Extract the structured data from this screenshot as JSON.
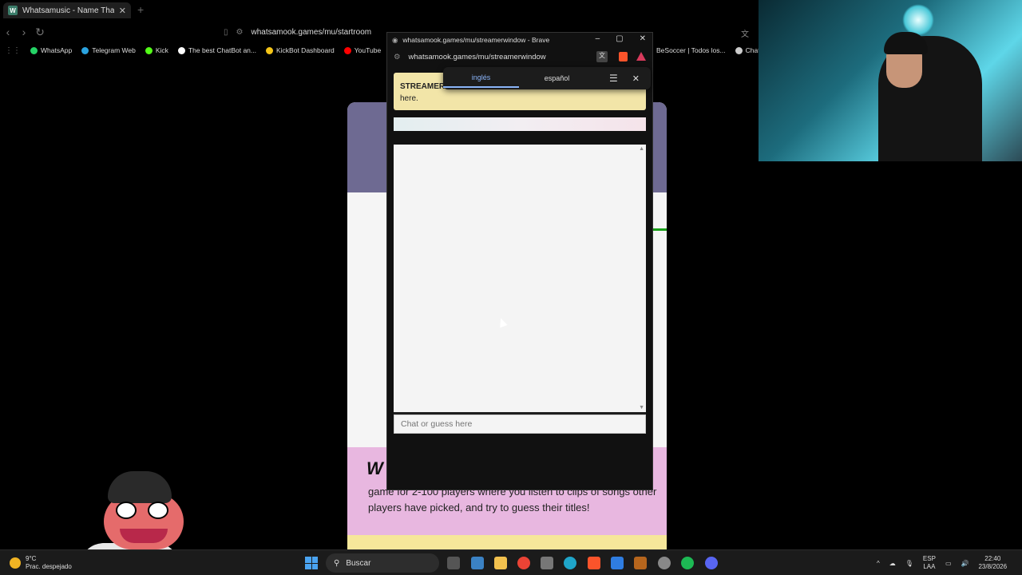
{
  "browser": {
    "tab_title": "Whatsamusic - Name That Tune",
    "tab_favicon": "W",
    "url": "whatsamook.games/mu/startroom",
    "bookmarks": [
      {
        "label": "WhatsApp",
        "color": "#25d366"
      },
      {
        "label": "Telegram Web",
        "color": "#2aa3e0"
      },
      {
        "label": "Kick",
        "color": "#53fc18"
      },
      {
        "label": "The best ChatBot an...",
        "color": "#ffffff"
      },
      {
        "label": "KickBot Dashboard",
        "color": "#f5c518"
      },
      {
        "label": "YouTube",
        "color": "#ff0000"
      }
    ],
    "bookmarks_right": [
      {
        "label": "BeSoccer | Todos los...",
        "color": "#888"
      },
      {
        "label": "ChatGP",
        "color": "#ccc"
      }
    ]
  },
  "page": {
    "tagline": "game for 2-100 players where you listen to clips of songs other players have picked, and try to guess their titles!"
  },
  "popup": {
    "title": "whatsamook.games/mu/streamerwindow - Brave",
    "url": "whatsamook.games/mu/streamerwindow",
    "banner_bold": "STREAMER",
    "banner_text": "here.",
    "chat_placeholder": "Chat or guess here"
  },
  "translate": {
    "lang_from": "inglés",
    "lang_to": "español"
  },
  "taskbar": {
    "weather_temp": "9°C",
    "weather_desc": "Prac. despejado",
    "search_label": "Buscar",
    "lang_code": "ESP",
    "lang_region": "LAA",
    "time": "22:40",
    "date": "23/8/2026"
  }
}
